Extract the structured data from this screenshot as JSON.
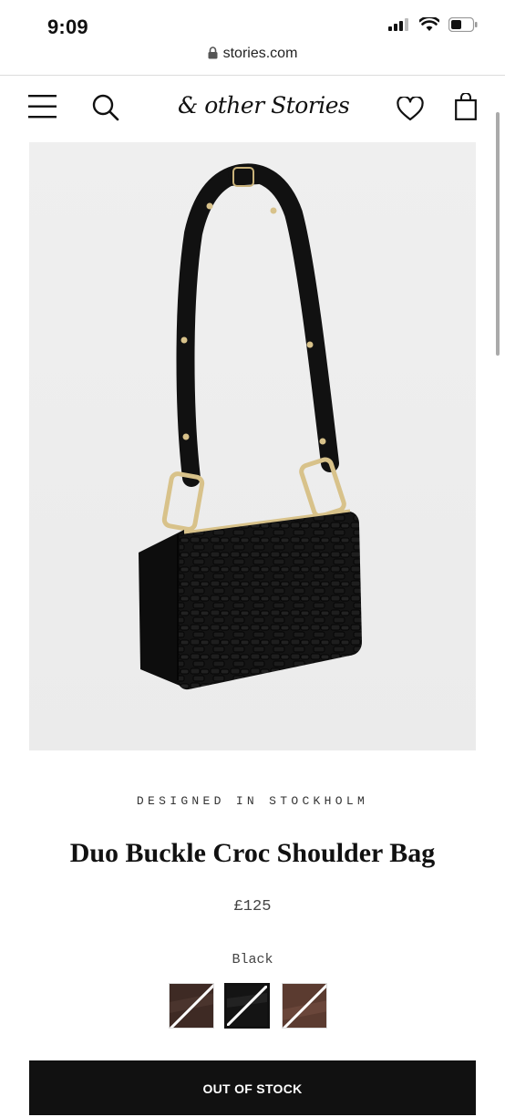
{
  "status_bar": {
    "time": "9:09"
  },
  "browser": {
    "url": "stories.com"
  },
  "nav": {
    "logo": "& other Stories",
    "icons": [
      "menu-icon",
      "search-icon",
      "heart-icon",
      "shopping-bag-icon"
    ]
  },
  "product": {
    "tagline": "DESIGNED IN STOCKHOLM",
    "name": "Duo Buckle Croc Shoulder Bag",
    "price": "£125",
    "color": "Black",
    "swatches": [
      {
        "name": "Dark brown",
        "color": "#3e2a24",
        "selected": false,
        "out_of_stock": true
      },
      {
        "name": "Black",
        "color": "#141414",
        "selected": true,
        "out_of_stock": true
      },
      {
        "name": "Brown",
        "color": "#5b3b30",
        "selected": false,
        "out_of_stock": true
      }
    ],
    "button": "OUT OF STOCK"
  },
  "colors": {
    "image_bg": "#eeeeee",
    "button_bg": "#111111",
    "accent_gold": "#d8c28a"
  }
}
